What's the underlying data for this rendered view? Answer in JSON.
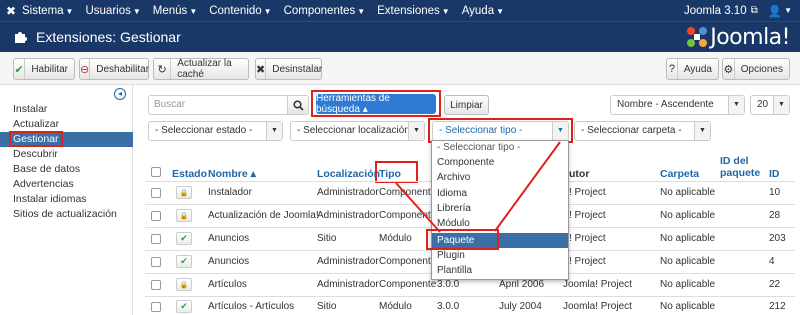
{
  "topnav": {
    "menus": [
      "Sistema",
      "Usuarios",
      "Menús",
      "Contenido",
      "Componentes",
      "Extensiones",
      "Ayuda"
    ],
    "site": "Joomla 3.10",
    "icons": [
      "joomla-icon",
      "external-link-icon",
      "user-icon"
    ]
  },
  "titlebar": {
    "title": "Extensiones: Gestionar",
    "brand": "Joomla!"
  },
  "toolbar": {
    "enable": "Habilitar",
    "disable": "Deshabilitar",
    "refresh_cache": "Actualizar la caché",
    "uninstall": "Desinstalar",
    "help": "Ayuda",
    "options": "Opciones"
  },
  "sidebar": {
    "items": [
      "Instalar",
      "Actualizar",
      "Gestionar",
      "Descubrir",
      "Base de datos",
      "Advertencias",
      "Instalar idiomas",
      "Sitios de actualización"
    ],
    "active": "Gestionar"
  },
  "filters": {
    "search_placeholder": "Buscar",
    "search_tools": "Herramientas de búsqueda ▴",
    "clear": "Limpiar",
    "sort": "Nombre - Ascendente",
    "limit": "20",
    "state": "- Seleccionar estado -",
    "location": "- Seleccionar localización -",
    "type": "- Seleccionar tipo -",
    "folder": "- Seleccionar carpeta -"
  },
  "table": {
    "headers": {
      "status": "Estado",
      "name": "Nombre ▴",
      "location": "Localización",
      "type": "Tipo",
      "author_fragment": "utor",
      "folder": "Carpeta",
      "package_id_1": "ID del",
      "package_id_2": "paquete",
      "id": "ID"
    },
    "rows": [
      {
        "name": "Instalador",
        "location": "Administrador",
        "type": "Componente",
        "version": "",
        "date": "",
        "author": "! Project",
        "folder": "No aplicable",
        "id": "10",
        "enabled": false
      },
      {
        "name": "Actualización de Joomla!",
        "location": "Administrador",
        "type": "Componente",
        "version": "",
        "date": "",
        "author": "! Project",
        "folder": "No aplicable",
        "id": "28",
        "enabled": false
      },
      {
        "name": "Anuncios",
        "location": "Sitio",
        "type": "Módulo",
        "version": "",
        "date": "",
        "author": "! Project",
        "folder": "No aplicable",
        "id": "203",
        "enabled": true
      },
      {
        "name": "Anuncios",
        "location": "Administrador",
        "type": "Componente",
        "version": "",
        "date": "",
        "author": "! Project",
        "folder": "No aplicable",
        "id": "4",
        "enabled": true
      },
      {
        "name": "Artículos",
        "location": "Administrador",
        "type": "Componente",
        "version": "3.0.0",
        "date": "April 2006",
        "author": "Joomla! Project",
        "folder": "No aplicable",
        "id": "22",
        "enabled": false
      },
      {
        "name": "Artículos - Artículos",
        "location": "Sitio",
        "type": "Módulo",
        "version": "3.0.0",
        "date": "July 2004",
        "author": "Joomla! Project",
        "folder": "No aplicable",
        "id": "212",
        "enabled": true
      }
    ]
  },
  "type_dropdown": {
    "options": [
      "- Seleccionar tipo -",
      "Componente",
      "Archivo",
      "Idioma",
      "Librería",
      "Módulo",
      "Paquete",
      "Plugin",
      "Plantilla"
    ],
    "highlighted": "Paquete"
  },
  "colors": {
    "nav": "#1a3867",
    "primary": "#2f7bd4",
    "link": "#1f67a8",
    "annotation": "#e0201a",
    "selected": "#3a70a6"
  }
}
